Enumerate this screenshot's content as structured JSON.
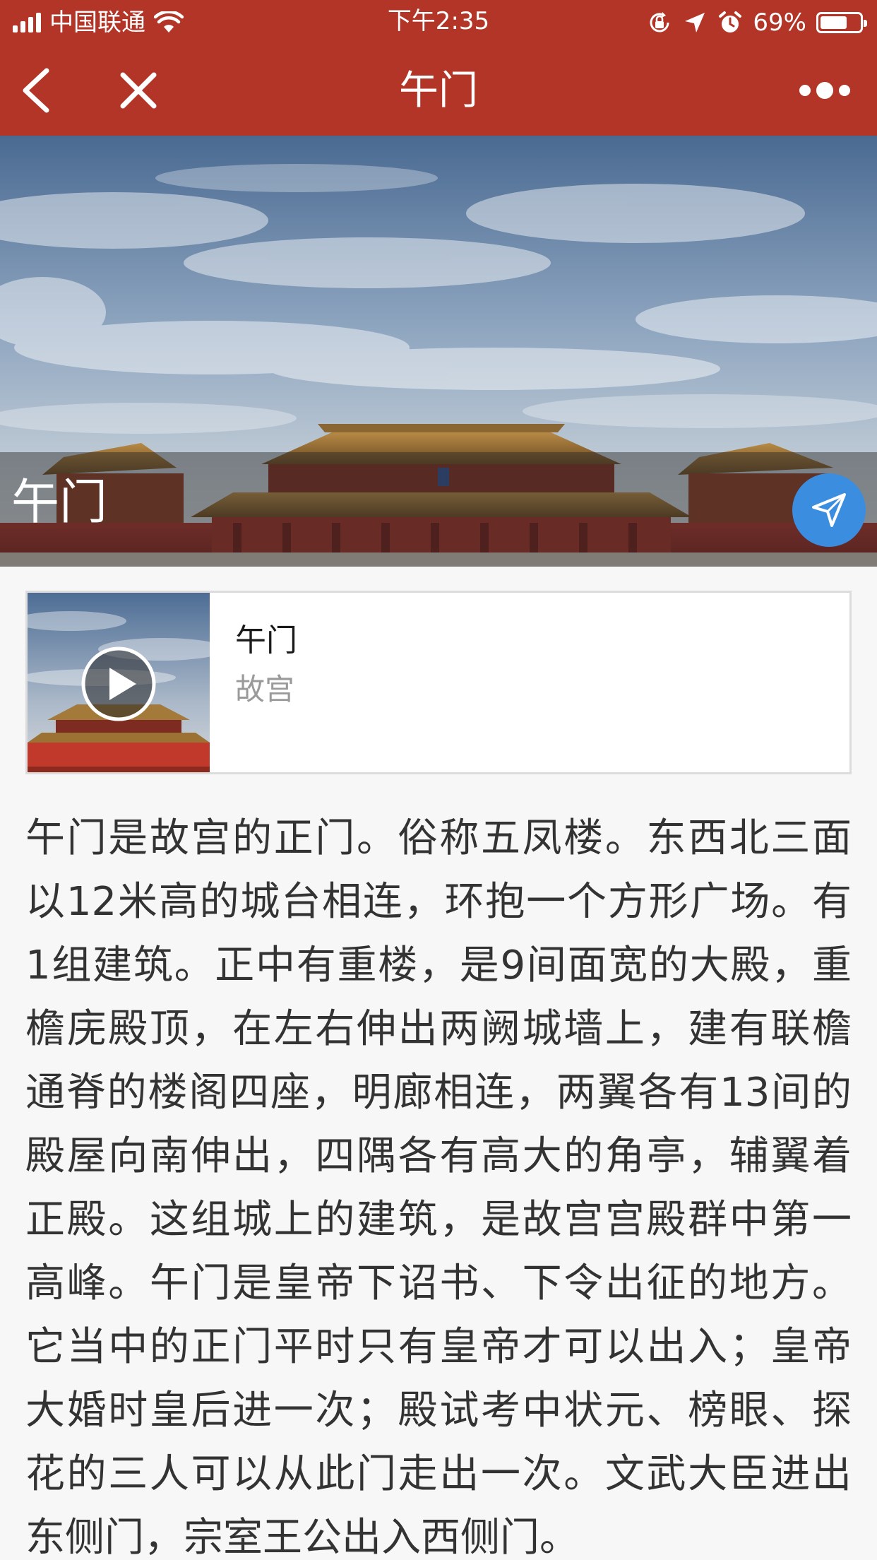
{
  "status_bar": {
    "carrier": "中国联通",
    "time": "下午2:35",
    "battery": "69%",
    "battery_level": 0.69
  },
  "nav_bar": {
    "title": "午门"
  },
  "hero": {
    "title": "午门"
  },
  "media_card": {
    "title": "午门",
    "subtitle": "故宫"
  },
  "description": "午门是故宫的正门。俗称五凤楼。东西北三面以12米高的城台相连，环抱一个方形广场。有1组建筑。正中有重楼，是9间面宽的大殿，重檐庑殿顶，在左右伸出两阙城墙上，建有联檐通脊的楼阁四座，明廊相连，两翼各有13间的殿屋向南伸出，四隅各有高大的角亭，辅翼着正殿。这组城上的建筑，是故宫宫殿群中第一高峰。午门是皇帝下诏书、下令出征的地方。它当中的正门平时只有皇帝才可以出入；皇帝大婚时皇后进一次；殿试考中状元、榜眼、探花的三人可以从此门走出一次。文武大臣进出东侧门，宗室王公出入西侧门。",
  "colors": {
    "header": "#b23527",
    "accent_blue": "#3b8de0",
    "background": "#f7f7f7"
  }
}
